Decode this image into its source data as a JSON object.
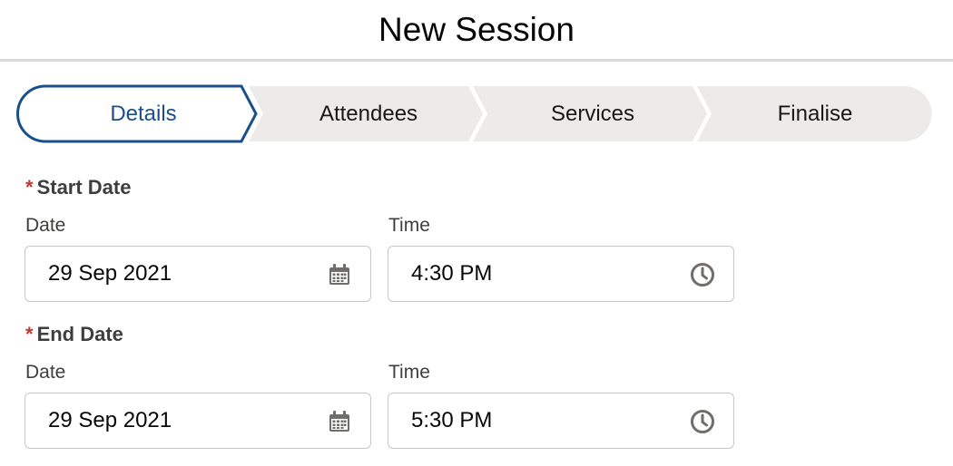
{
  "modal": {
    "title": "New Session"
  },
  "path": {
    "stages": [
      {
        "label": "Details",
        "active": true
      },
      {
        "label": "Attendees",
        "active": false
      },
      {
        "label": "Services",
        "active": false
      },
      {
        "label": "Finalise",
        "active": false
      }
    ]
  },
  "start": {
    "required_mark": "*",
    "label": "Start Date",
    "date_label": "Date",
    "date_value": "29 Sep 2021",
    "time_label": "Time",
    "time_value": "4:30 PM"
  },
  "end": {
    "required_mark": "*",
    "label": "End Date",
    "date_label": "Date",
    "date_value": "29 Sep 2021",
    "time_label": "Time",
    "time_value": "5:30 PM"
  },
  "icons": {
    "date": "calendar-icon",
    "time": "clock-icon"
  },
  "colors": {
    "active_stage": "#1b4f8a",
    "inactive_stage": "#ecebea",
    "required": "#c23934"
  }
}
